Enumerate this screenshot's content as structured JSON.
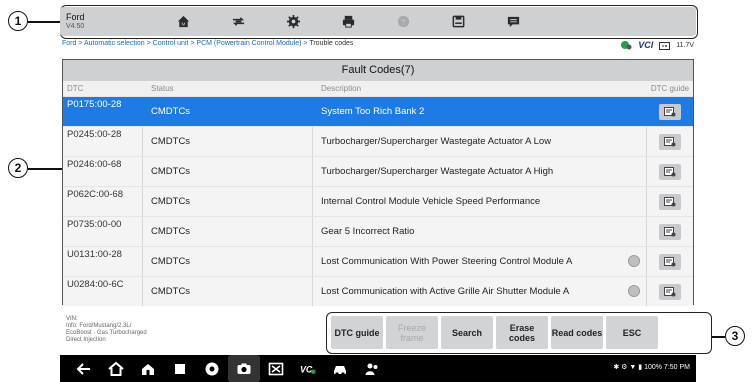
{
  "toolbar": {
    "title": "Ford",
    "version": "V4.50",
    "icons": [
      "home-icon",
      "vehicle-swap-icon",
      "settings-icon",
      "print-icon",
      "help-icon",
      "save-icon",
      "message-icon"
    ]
  },
  "breadcrumb": {
    "path": "Ford > Automatic selection > Control unit > PCM (Powertrain Control Module) >",
    "current": "Trouble codes",
    "vci_label": "VCI",
    "voltage": "11.7V"
  },
  "panel": {
    "title": "Fault Codes(7)",
    "headers": {
      "dtc": "DTC",
      "status": "Status",
      "description": "Description",
      "guide": "DTC guide"
    },
    "rows": [
      {
        "dtc": "P0175:00-28",
        "status": "CMDTCs",
        "description": "System Too Rich Bank 2",
        "selected": true,
        "freeze": false
      },
      {
        "dtc": "P0245:00-28",
        "status": "CMDTCs",
        "description": "Turbocharger/Supercharger Wastegate Actuator A Low",
        "selected": false,
        "freeze": false
      },
      {
        "dtc": "P0246:00-68",
        "status": "CMDTCs",
        "description": "Turbocharger/Supercharger Wastegate Actuator A High",
        "selected": false,
        "freeze": false
      },
      {
        "dtc": "P062C:00-68",
        "status": "CMDTCs",
        "description": "Internal Control Module Vehicle Speed Performance",
        "selected": false,
        "freeze": false
      },
      {
        "dtc": "P0735:00-00",
        "status": "CMDTCs",
        "description": "Gear 5 Incorrect Ratio",
        "selected": false,
        "freeze": false
      },
      {
        "dtc": "U0131:00-28",
        "status": "CMDTCs",
        "description": "Lost Communication With Power Steering Control Module A",
        "selected": false,
        "freeze": true
      },
      {
        "dtc": "U0284:00-6C",
        "status": "CMDTCs",
        "description": "Lost Communication with Active Grille Air Shutter Module A",
        "selected": false,
        "freeze": true
      }
    ]
  },
  "vehicle_info": {
    "vin": "VIN:",
    "info": "Info: Ford/Mustang/2.3L/",
    "engine": "EcoBoost · Gas Turbocharged",
    "injection": "Direct Injection"
  },
  "functions": {
    "dtc_guide": "DTC guide",
    "freeze_frame": "Freeze frame",
    "search": "Search",
    "erase_codes": "Erase codes",
    "read_codes": "Read codes",
    "esc": "ESC"
  },
  "callouts": [
    "1",
    "2",
    "3"
  ],
  "navbar": {
    "status": "✱ ⚙ ▼ ▮ 100% 7:50 PM"
  },
  "colors": {
    "selected_row": "#1e7be6",
    "toolbar": "#cfd0d2",
    "link": "#1a66c9"
  }
}
